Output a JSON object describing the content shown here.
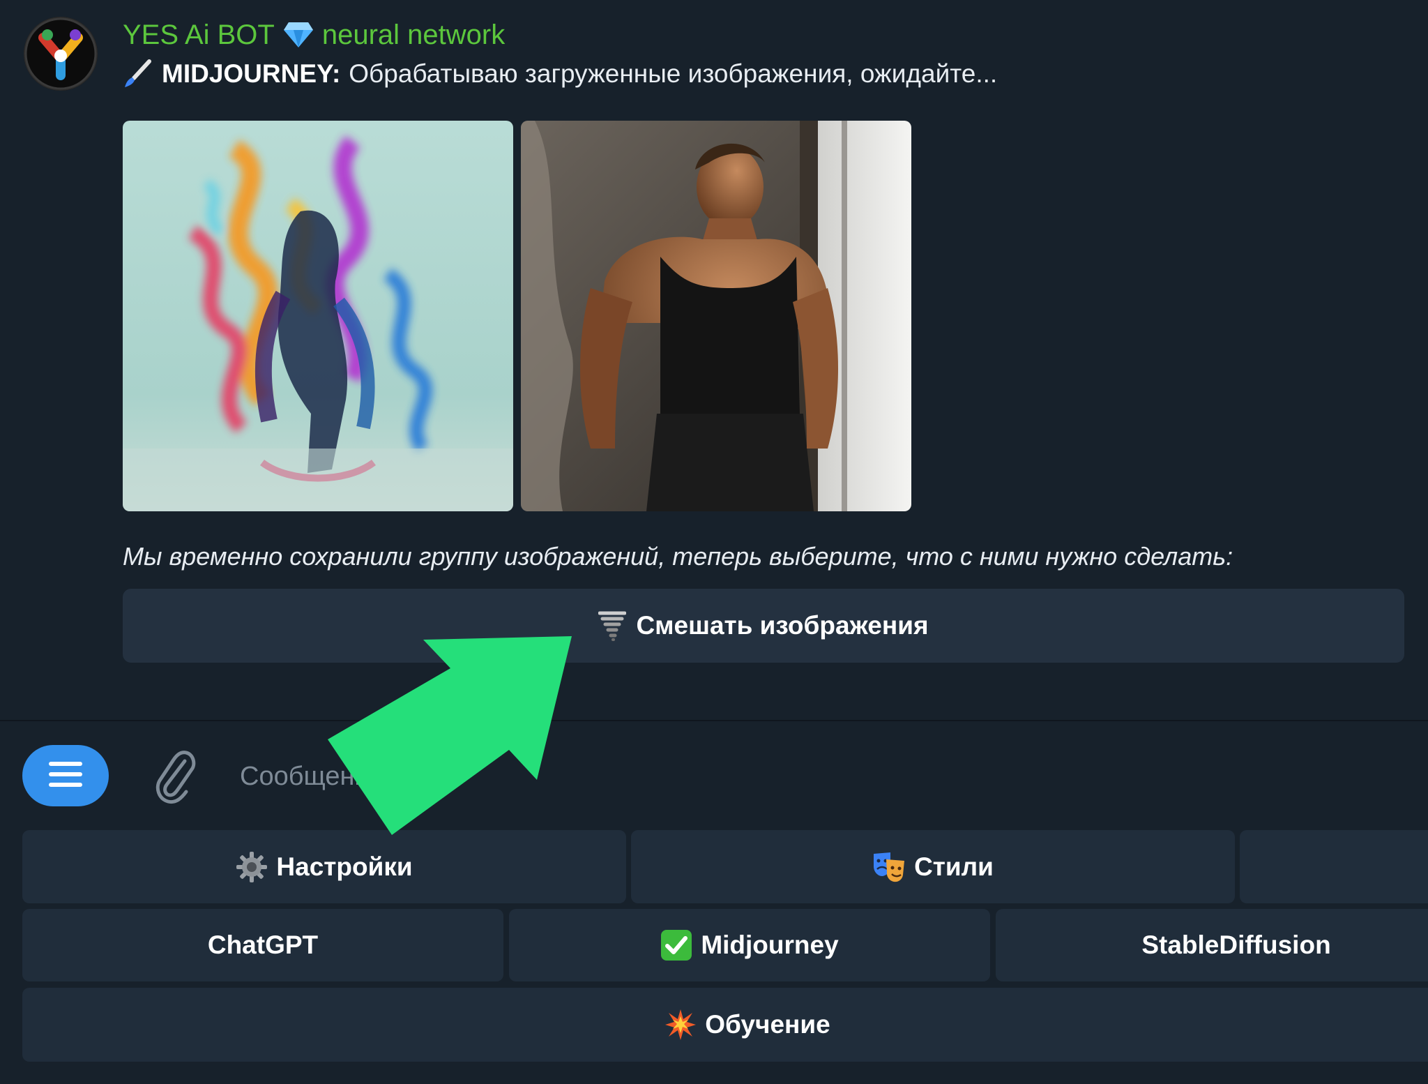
{
  "message": {
    "sender_name": "YES Ai BOT",
    "sender_suffix": "neural network",
    "service_label": "MIDJOURNEY:",
    "status_text": "Обрабатываю загруженные изображения, ожидайте...",
    "caption": "Мы временно сохранили группу изображений, теперь выберите, что с ними нужно сделать:",
    "images": [
      "colorful-ink-smoke-figure",
      "muscular-man-by-window"
    ]
  },
  "inline_keyboard": {
    "blend_label": "Смешать изображения"
  },
  "composer": {
    "placeholder": "Сообщение"
  },
  "reply_keyboard": {
    "row1": [
      "Настройки",
      "Стили",
      ""
    ],
    "row2": [
      "ChatGPT",
      "Midjourney",
      "StableDiffusion"
    ],
    "row3": [
      "Обучение"
    ]
  },
  "colors": {
    "background": "#17212b",
    "sender_green": "#5cc73d",
    "button_bg": "#243140",
    "menu_blue": "#3390ec",
    "arrow_green": "#25df7a"
  },
  "icons": [
    "bot-avatar-icon",
    "diamond-icon",
    "paintbrush-icon",
    "tornado-icon",
    "menu-icon",
    "paperclip-icon",
    "gear-icon",
    "theater-masks-icon",
    "check-mark-icon",
    "collision-icon",
    "arrow-pointer-icon"
  ]
}
